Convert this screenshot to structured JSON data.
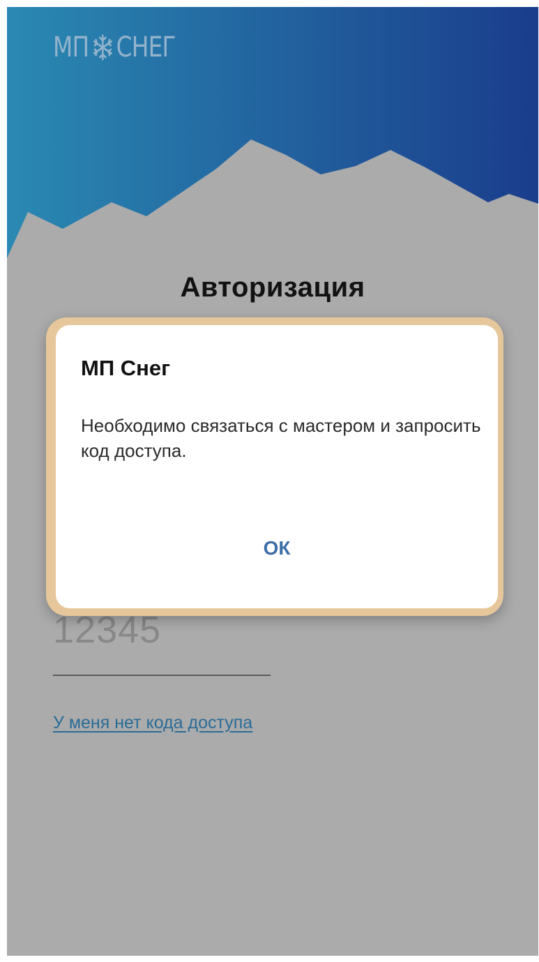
{
  "app": {
    "logo_left": "МП",
    "logo_right": "СНЕГ",
    "logo_icon": "snowflake-icon"
  },
  "screen": {
    "title": "Авторизация",
    "code_value": "12345",
    "no_code_link": "У меня нет кода доступа"
  },
  "dialog": {
    "title": "МП Снег",
    "message": "Необходимо связаться с мастером и запросить код доступа.",
    "ok_label": "ОК"
  },
  "colors": {
    "header_gradient_start": "#2a8ab3",
    "header_gradient_end": "#1a3f8e",
    "background": "#ababab",
    "dialog_highlight": "#e6c79c",
    "accent": "#3c6ea7",
    "link": "#2a6c97"
  }
}
